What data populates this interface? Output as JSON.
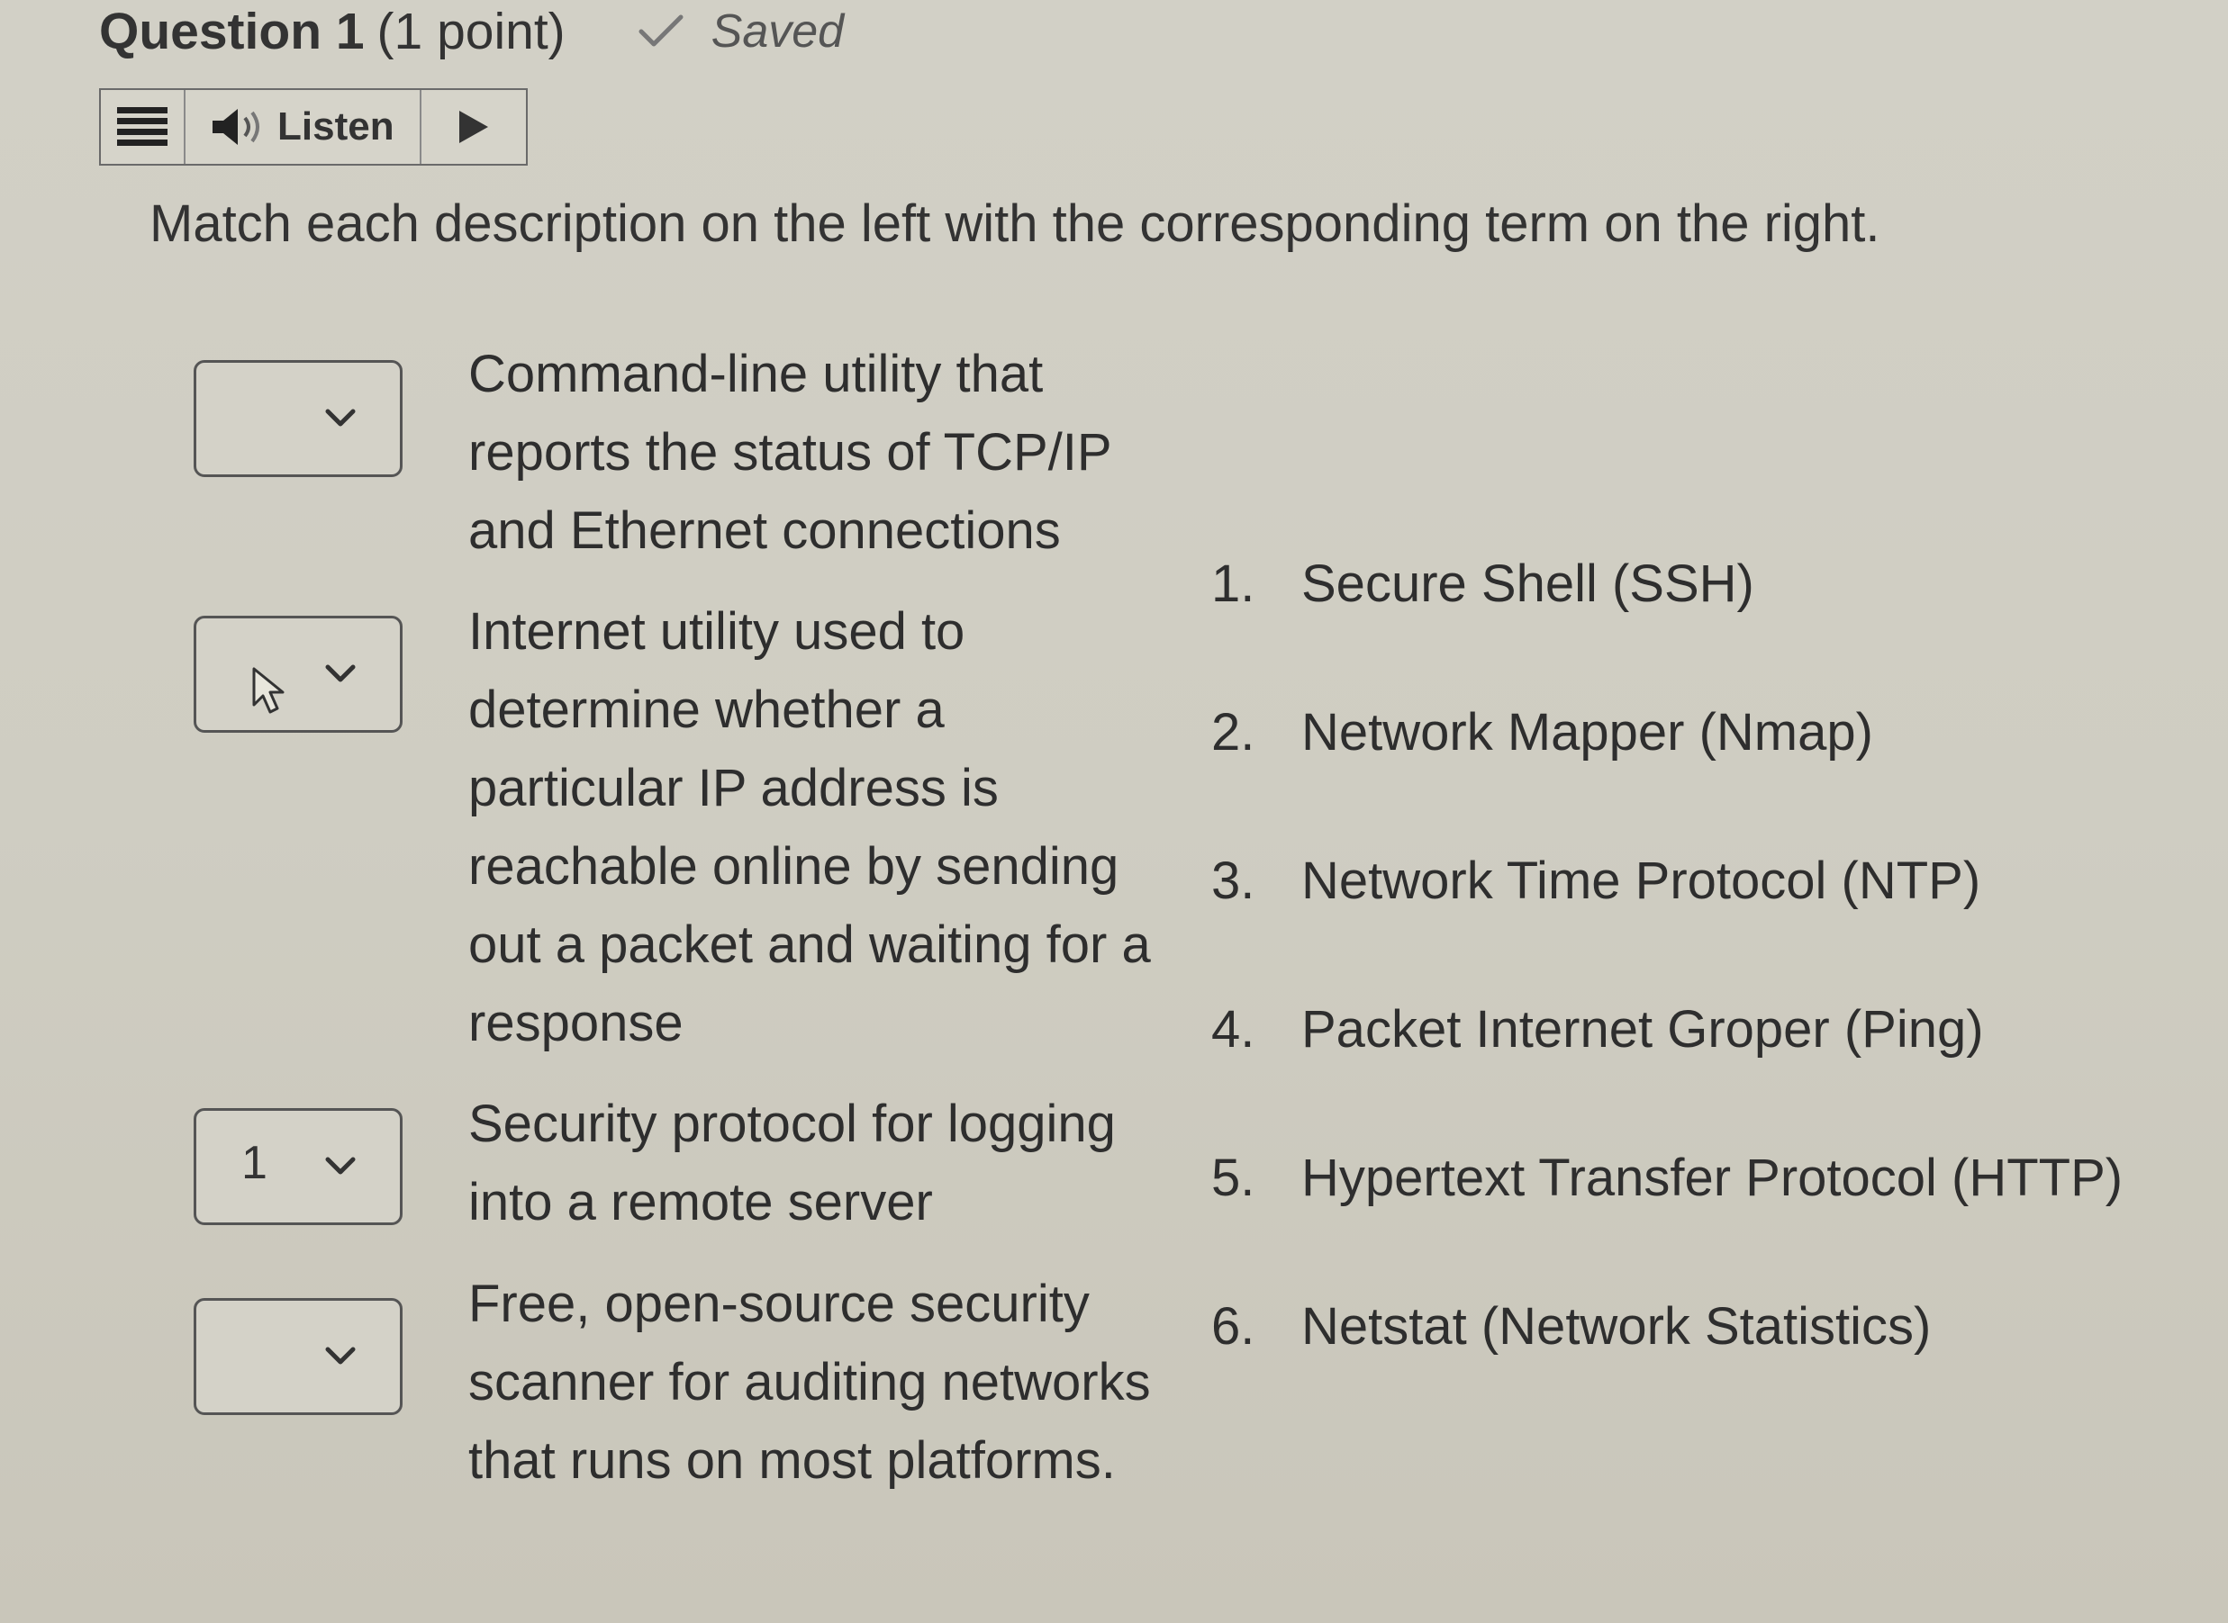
{
  "header": {
    "title": "Question 1",
    "points": "(1 point)",
    "status": "Saved",
    "status_icon": "check-icon"
  },
  "toolbar": {
    "menu_icon": "menu-icon",
    "listen_icon": "speaker-icon",
    "listen_label": "Listen",
    "play_icon": "play-icon"
  },
  "instructions": "Match each description on the left with the corresponding term on the right.",
  "descriptions": [
    {
      "selected": "",
      "text": "Command-line utility that reports the status of TCP/IP and Ethernet connections"
    },
    {
      "selected": "",
      "text": "Internet utility used to determine whether a particular IP address is reachable online by sending out a packet and waiting for a response"
    },
    {
      "selected": "1",
      "text": "Security protocol for logging into a remote server"
    },
    {
      "selected": "",
      "text": "Free, open-source security scanner for auditing networks that runs on most platforms."
    }
  ],
  "terms": [
    {
      "number": "1.",
      "label": "Secure Shell (SSH)"
    },
    {
      "number": "2.",
      "label": "Network Mapper (Nmap)"
    },
    {
      "number": "3.",
      "label": "Network Time Protocol (NTP)"
    },
    {
      "number": "4.",
      "label": "Packet Internet Groper (Ping)"
    },
    {
      "number": "5.",
      "label": "Hypertext Transfer Protocol (HTTP)"
    },
    {
      "number": "6.",
      "label": "Netstat (Network Statistics)"
    }
  ]
}
